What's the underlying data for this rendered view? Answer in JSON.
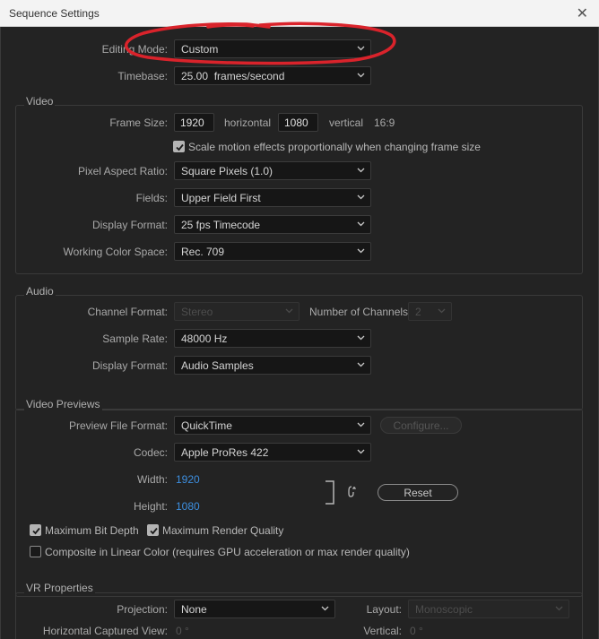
{
  "window": {
    "title": "Sequence Settings"
  },
  "editing_mode": {
    "label": "Editing Mode:",
    "value": "Custom"
  },
  "timebase": {
    "label": "Timebase:",
    "value": "25.00  frames/second"
  },
  "video": {
    "title": "Video",
    "frame_size_label": "Frame Size:",
    "width": "1920",
    "horizontal": "horizontal",
    "height": "1080",
    "vertical": "vertical",
    "aspect": "16:9",
    "scale_motion": "Scale motion effects proportionally when changing frame size",
    "par_label": "Pixel Aspect Ratio:",
    "par_value": "Square Pixels (1.0)",
    "fields_label": "Fields:",
    "fields_value": "Upper Field First",
    "display_format_label": "Display Format:",
    "display_format_value": "25 fps Timecode",
    "color_space_label": "Working Color Space:",
    "color_space_value": "Rec. 709"
  },
  "audio": {
    "title": "Audio",
    "channel_format_label": "Channel Format:",
    "channel_format_value": "Stereo",
    "num_channels_label": "Number of Channels:",
    "num_channels_value": "2",
    "sample_rate_label": "Sample Rate:",
    "sample_rate_value": "48000 Hz",
    "display_format_label": "Display Format:",
    "display_format_value": "Audio Samples"
  },
  "previews": {
    "title": "Video Previews",
    "preview_format_label": "Preview File Format:",
    "preview_format_value": "QuickTime",
    "configure": "Configure...",
    "codec_label": "Codec:",
    "codec_value": "Apple ProRes 422",
    "width_label": "Width:",
    "width_value": "1920",
    "height_label": "Height:",
    "height_value": "1080",
    "reset": "Reset",
    "max_bit_depth": "Maximum Bit Depth",
    "max_render_quality": "Maximum Render Quality",
    "composite_linear": "Composite in Linear Color (requires GPU acceleration or max render quality)"
  },
  "vr": {
    "title": "VR Properties",
    "projection_label": "Projection:",
    "projection_value": "None",
    "layout_label": "Layout:",
    "layout_value": "Monoscopic",
    "hcv_label": "Horizontal Captured View:",
    "hcv_value": "0 °",
    "vertical_label": "Vertical:",
    "vertical_value": "0 °"
  },
  "colors": {
    "annotation": "#d9232b",
    "link_value": "#3d8fe0"
  }
}
